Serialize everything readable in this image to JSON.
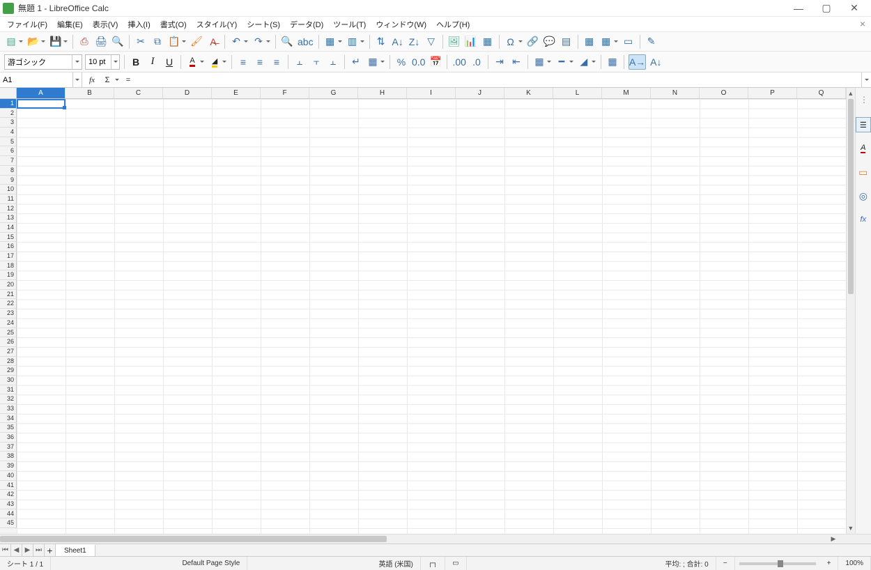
{
  "title": "無題 1 - LibreOffice Calc",
  "menu": [
    "ファイル(F)",
    "編集(E)",
    "表示(V)",
    "挿入(I)",
    "書式(O)",
    "スタイル(Y)",
    "シート(S)",
    "データ(D)",
    "ツール(T)",
    "ウィンドウ(W)",
    "ヘルプ(H)"
  ],
  "font_name": "游ゴシック",
  "font_size": "10 pt",
  "cell_ref": "A1",
  "formula": "",
  "columns": [
    "A",
    "B",
    "C",
    "D",
    "E",
    "F",
    "G",
    "H",
    "I",
    "J",
    "K",
    "L",
    "M",
    "N",
    "O",
    "P",
    "Q"
  ],
  "rows": 45,
  "active_col": "A",
  "active_row": 1,
  "sheet_tab": "Sheet1",
  "status": {
    "sheet": "シート 1 / 1",
    "style": "Default Page Style",
    "lang": "英語 (米国)",
    "insert": "┌┐",
    "sel": "▭",
    "summary": "平均: ; 合計: 0",
    "zoom_minus": "−",
    "zoom_plus": "+",
    "zoom": "100%"
  },
  "fx_sigma": "Σ",
  "fx_eq": "="
}
